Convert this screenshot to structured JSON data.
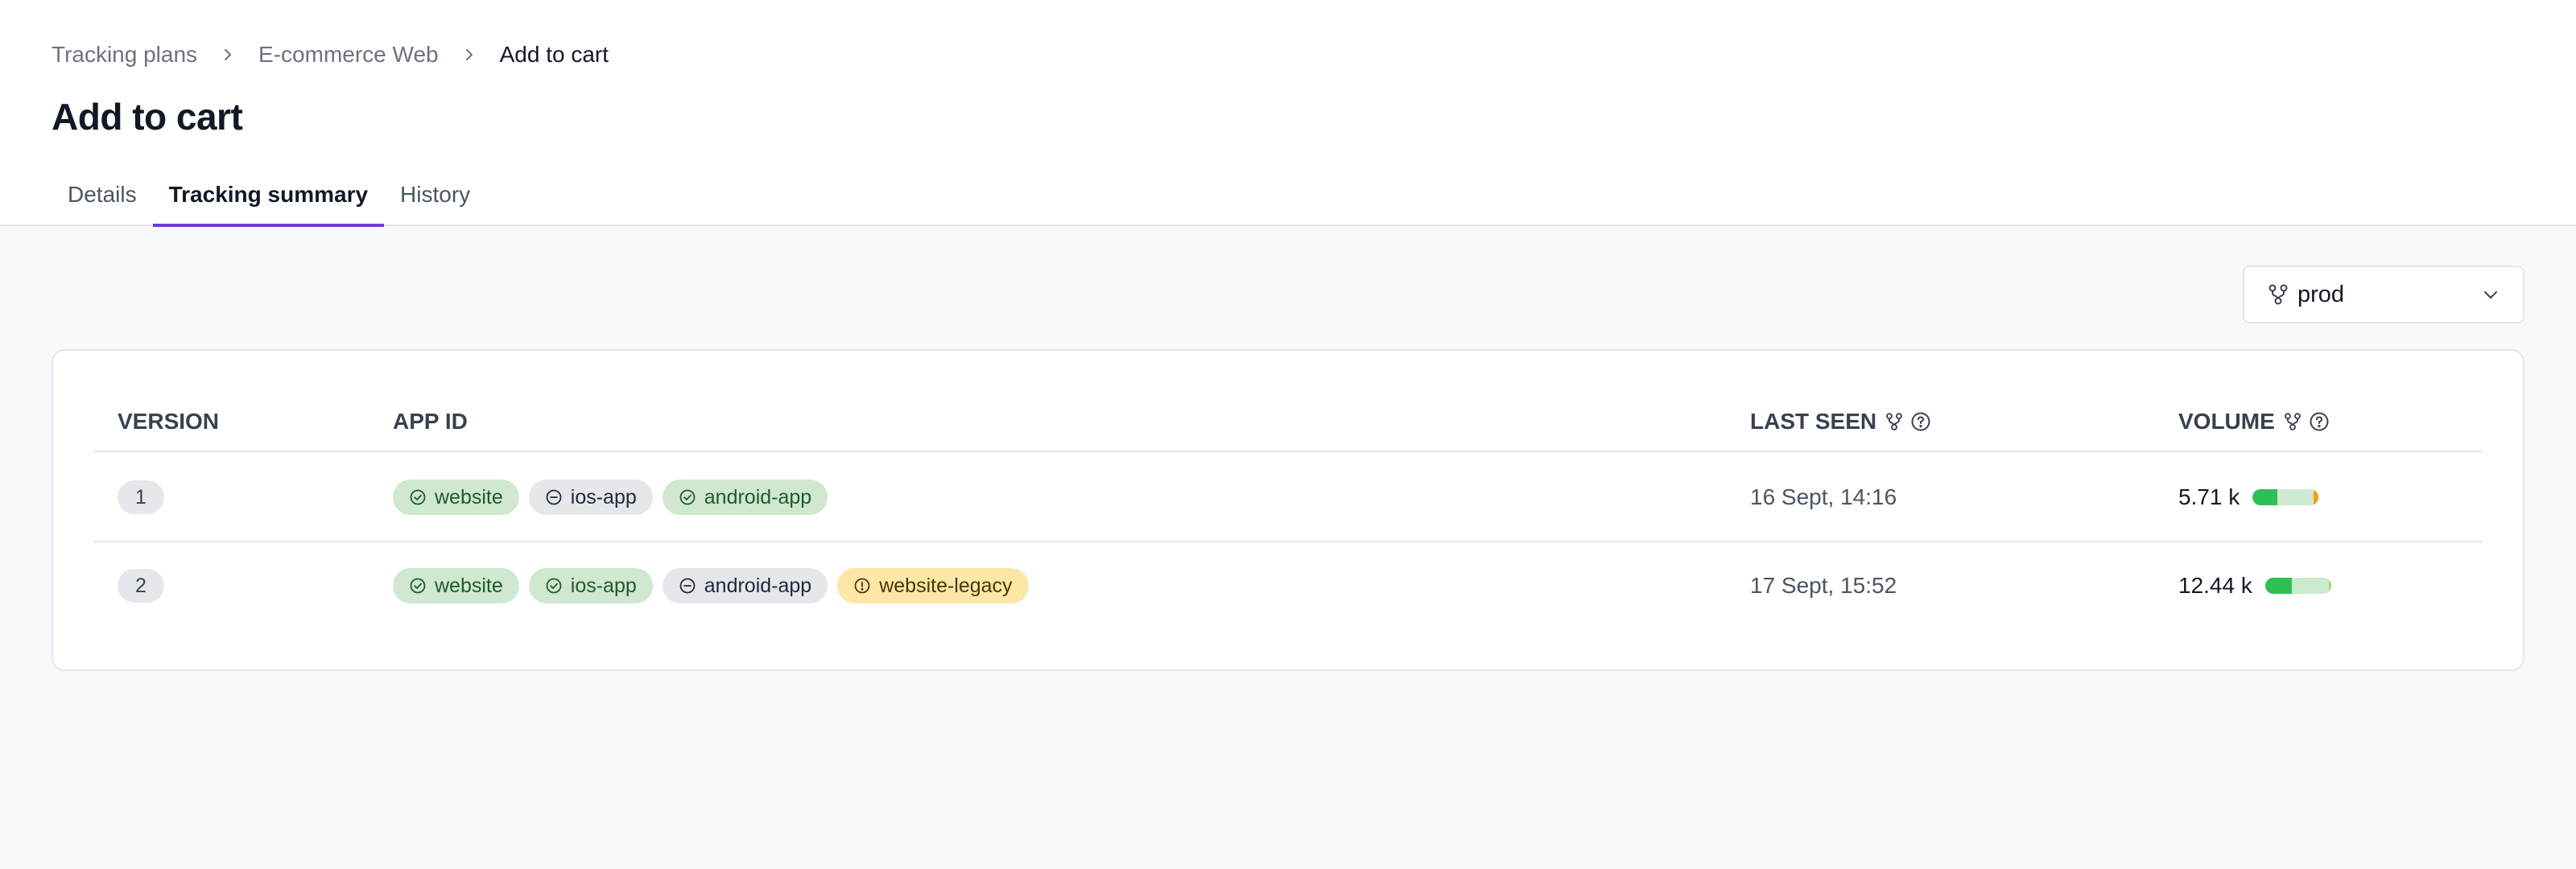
{
  "breadcrumb": [
    "Tracking plans",
    "E-commerce Web",
    "Add to cart"
  ],
  "page_title": "Add to cart",
  "tabs": [
    {
      "label": "Details",
      "active": false
    },
    {
      "label": "Tracking summary",
      "active": true
    },
    {
      "label": "History",
      "active": false
    }
  ],
  "environment": {
    "selected": "prod"
  },
  "table": {
    "headers": {
      "version": "VERSION",
      "app_id": "APP ID",
      "last_seen": "LAST SEEN",
      "volume": "VOLUME"
    },
    "rows": [
      {
        "version": "1",
        "apps": [
          {
            "name": "website",
            "status": "ok"
          },
          {
            "name": "ios-app",
            "status": "off"
          },
          {
            "name": "android-app",
            "status": "ok"
          }
        ],
        "last_seen": "16 Sept, 14:16",
        "volume": "5.71 k",
        "volume_split": {
          "green": 0.37,
          "light": 0.55,
          "orange": 0.08
        }
      },
      {
        "version": "2",
        "apps": [
          {
            "name": "website",
            "status": "ok"
          },
          {
            "name": "ios-app",
            "status": "ok"
          },
          {
            "name": "android-app",
            "status": "off"
          },
          {
            "name": "website-legacy",
            "status": "warn"
          }
        ],
        "last_seen": "17 Sept, 15:52",
        "volume": "12.44 k",
        "volume_split": {
          "green": 0.4,
          "light": 0.57,
          "lime": 0.03
        }
      }
    ]
  },
  "colors": {
    "accent": "#6d3bd1",
    "ok_bg": "#cfe8cf",
    "warn_bg": "#fde7a6",
    "neutral_bg": "#e5e7eb",
    "bar_green": "#2fbf55",
    "bar_orange": "#f59e0b"
  },
  "icons": {
    "breadcrumb_separator": "chevron-right-icon",
    "environment": "branch-icon",
    "select": "chevron-down-icon",
    "header_info": "help-circle-icon",
    "status_ok": "check-circle-icon",
    "status_off": "minus-circle-icon",
    "status_warn": "alert-circle-icon"
  }
}
